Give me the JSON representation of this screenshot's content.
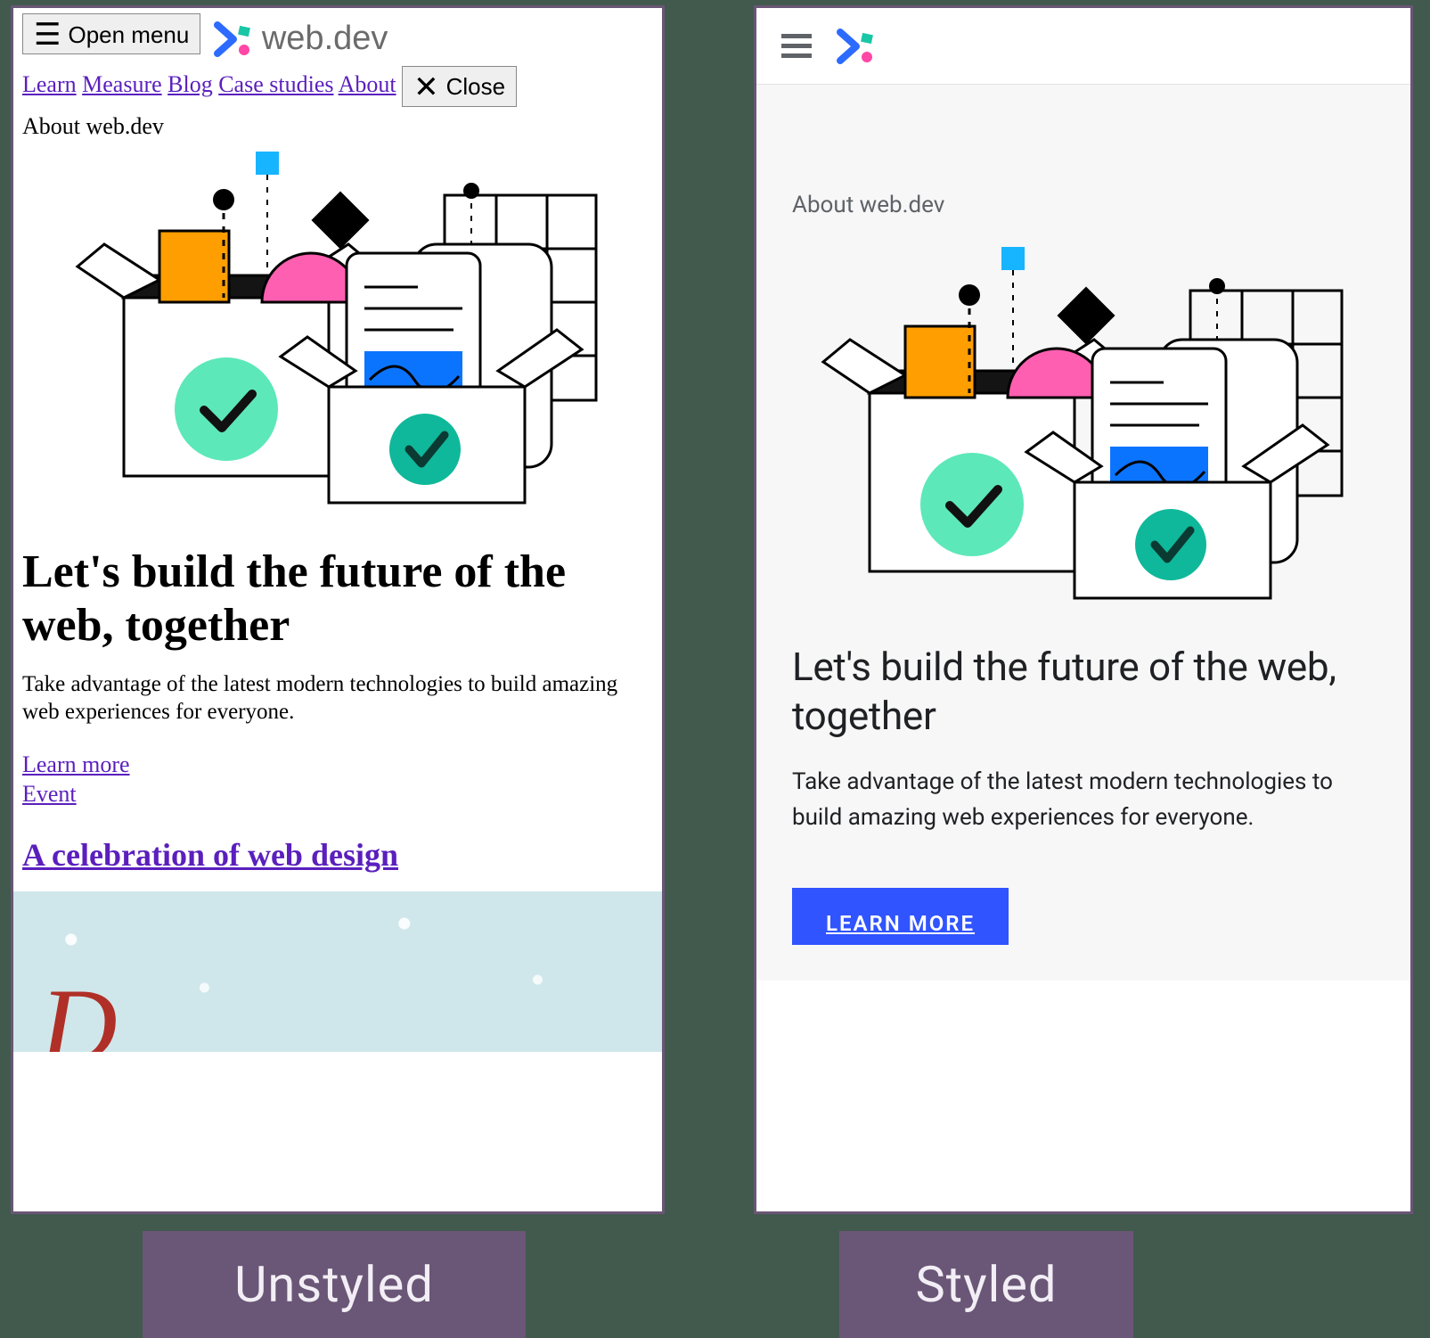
{
  "comparison": {
    "left_caption": "Unstyled",
    "right_caption": "Styled"
  },
  "site": {
    "name": "web.dev",
    "eyebrow": "About web.dev",
    "hero_title": "Let's build the future of the web, together",
    "hero_subtitle": "Take advantage of the latest modern technologies to build amazing web experiences for everyone."
  },
  "unstyled": {
    "open_menu_label": "Open menu",
    "close_label": "Close",
    "nav": {
      "learn": "Learn",
      "measure": "Measure",
      "blog": "Blog",
      "case_studies": "Case studies",
      "about": "About"
    },
    "learn_more_link": "Learn more",
    "event_link": "Event",
    "celebration_heading": "A celebration of web design"
  },
  "styled": {
    "cta_label": "LEARN MORE"
  }
}
